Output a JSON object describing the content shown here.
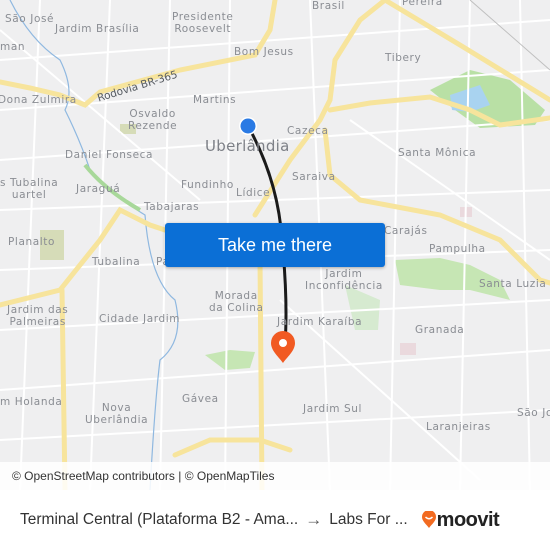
{
  "map": {
    "city_label": "Uberlândia",
    "road_label": "Rodovia BR-365",
    "neighborhoods": [
      {
        "id": "sao-jose",
        "name": "São José"
      },
      {
        "id": "jardim-brasilia",
        "name": "Jardim Brasília"
      },
      {
        "id": "presidente-roosevelt",
        "name": "Presidente\nRoosevelt"
      },
      {
        "id": "brasil",
        "name": "Brasil"
      },
      {
        "id": "pereira",
        "name": "Pereira"
      },
      {
        "id": "man",
        "name": "man"
      },
      {
        "id": "bom-jesus",
        "name": "Bom Jesus"
      },
      {
        "id": "tibery",
        "name": "Tibery"
      },
      {
        "id": "dona-zulmira",
        "name": "Dona Zulmira"
      },
      {
        "id": "martins",
        "name": "Martins"
      },
      {
        "id": "osvaldo-rezende",
        "name": "Osvaldo\nRezende"
      },
      {
        "id": "cazeca",
        "name": "Cazeca"
      },
      {
        "id": "daniel-fonseca",
        "name": "Daniel Fonseca"
      },
      {
        "id": "santa-monica",
        "name": "Santa Mônica"
      },
      {
        "id": "tubalina-quartel",
        "name": "s Tubalina\nuartel"
      },
      {
        "id": "jaragua",
        "name": "Jaraguá"
      },
      {
        "id": "fundinho",
        "name": "Fundinho"
      },
      {
        "id": "saraiva",
        "name": "Saraiva"
      },
      {
        "id": "lidice",
        "name": "Lídice"
      },
      {
        "id": "tabajaras",
        "name": "Tabajaras"
      },
      {
        "id": "carajas",
        "name": "Carajás"
      },
      {
        "id": "planalto",
        "name": "Planalto"
      },
      {
        "id": "pampulha",
        "name": "Pampulha"
      },
      {
        "id": "tubalina",
        "name": "Tubalina"
      },
      {
        "id": "pa",
        "name": "Pa"
      },
      {
        "id": "jardim-inconfidencia",
        "name": "Jardim\nInconfidência"
      },
      {
        "id": "santa-luzia",
        "name": "Santa Luzia"
      },
      {
        "id": "jardim-das-palmeiras",
        "name": "Jardim das\nPalmeiras"
      },
      {
        "id": "morada-da-colina",
        "name": "Morada\nda Colina"
      },
      {
        "id": "jardim-karaiba",
        "name": "Jardim Karaíba"
      },
      {
        "id": "cidade-jardim",
        "name": "Cidade Jardim"
      },
      {
        "id": "granada",
        "name": "Granada"
      },
      {
        "id": "holanda",
        "name": "m Holanda"
      },
      {
        "id": "gavea",
        "name": "Gávea"
      },
      {
        "id": "nova-uberlandia",
        "name": "Nova\nUberlândia"
      },
      {
        "id": "sao-jo",
        "name": "São Jo"
      },
      {
        "id": "jardim-sul",
        "name": "Jardim Sul"
      },
      {
        "id": "laranjeiras",
        "name": "Laranjeiras"
      }
    ],
    "origin_color": "#2a7ae4",
    "destination_color": "#f15a22",
    "route_color": "#1a1a1a"
  },
  "cta": {
    "label": "Take me there",
    "color": "#0b6fd6"
  },
  "attribution": "© OpenStreetMap contributors | © OpenMapTiles",
  "footer": {
    "origin": "Terminal Central (Plataforma B2 - Ama...",
    "arrow": "→",
    "destination": "Labs For ...",
    "brand": "moovit",
    "brand_color": "#f26b21"
  }
}
